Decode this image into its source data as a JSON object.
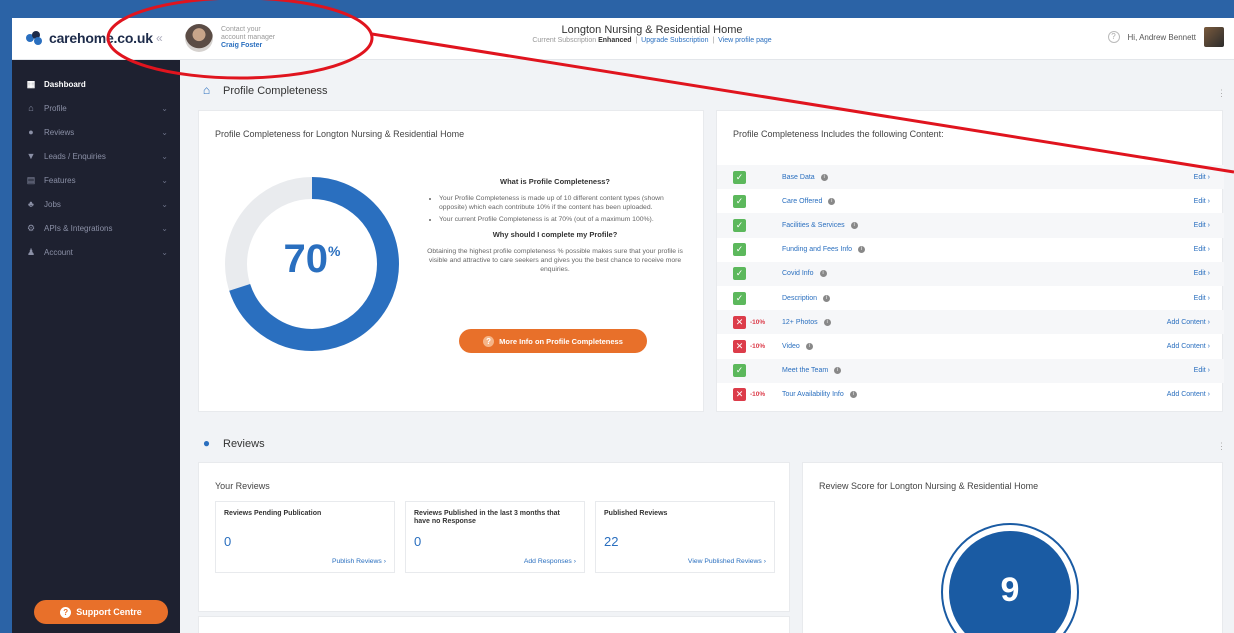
{
  "app": {
    "logo": "carehome.co.uk",
    "collapse": "«"
  },
  "manager": {
    "line1": "Contact your",
    "line2": "account manager",
    "name": "Craig Foster"
  },
  "header": {
    "title": "Longton Nursing & Residential Home",
    "subscription_label": "Current Subscription",
    "subscription_value": "Enhanced",
    "upgrade": "Upgrade Subscription",
    "view_profile": "View profile page",
    "sep": "|"
  },
  "user": {
    "help": "?",
    "greeting": "Hi, Andrew Bennett"
  },
  "sidebar": {
    "items": [
      {
        "label": "Dashboard",
        "icon": "▦"
      },
      {
        "label": "Profile",
        "icon": "⌂"
      },
      {
        "label": "Reviews",
        "icon": "●"
      },
      {
        "label": "Leads / Enquiries",
        "icon": "▼"
      },
      {
        "label": "Features",
        "icon": "▤"
      },
      {
        "label": "Jobs",
        "icon": "♣"
      },
      {
        "label": "APIs & Integrations",
        "icon": "⚙"
      },
      {
        "label": "Account",
        "icon": "♟"
      }
    ],
    "chevron": "⌄",
    "support": "Support Centre",
    "support_icon": "?"
  },
  "profile_section": {
    "heading": "Profile Completeness",
    "dots": "⋮",
    "card_title": "Profile Completeness for Longton Nursing & Residential Home",
    "percent": "70",
    "percent_sign": "%",
    "percent_value": 0.7,
    "what_title": "What is Profile Completeness?",
    "bullet1": "Your Profile Completeness is made up of 10 different content types (shown opposite) which each contribute 10% if the content has been uploaded.",
    "bullet2": "Your current Profile Completeness is at 70% (out of a maximum 100%).",
    "why_title": "Why should I complete my Profile?",
    "why_text": "Obtaining the highest profile completeness % possible makes sure that your profile is visible and attractive to care seekers and gives you the best chance to receive more enquiries.",
    "button": "More Info on Profile Completeness",
    "button_icon": "?",
    "includes_title": "Profile Completeness Includes the following Content:",
    "content": [
      {
        "name": "Base Data",
        "done": true,
        "minus": "",
        "action": "Edit"
      },
      {
        "name": "Care Offered",
        "done": true,
        "minus": "",
        "action": "Edit"
      },
      {
        "name": "Facilities & Services",
        "done": true,
        "minus": "",
        "action": "Edit"
      },
      {
        "name": "Funding and Fees Info",
        "done": true,
        "minus": "",
        "action": "Edit"
      },
      {
        "name": "Covid Info",
        "done": true,
        "minus": "",
        "action": "Edit"
      },
      {
        "name": "Description",
        "done": true,
        "minus": "",
        "action": "Edit"
      },
      {
        "name": "12+ Photos",
        "done": false,
        "minus": "-10%",
        "action": "Add Content"
      },
      {
        "name": "Video",
        "done": false,
        "minus": "-10%",
        "action": "Add Content"
      },
      {
        "name": "Meet the Team",
        "done": true,
        "minus": "",
        "action": "Edit"
      },
      {
        "name": "Tour Availability Info",
        "done": false,
        "minus": "-10%",
        "action": "Add Content"
      }
    ]
  },
  "reviews_section": {
    "heading": "Reviews",
    "dots": "⋮",
    "your_reviews": "Your Reviews",
    "stats": [
      {
        "label": "Reviews Pending Publication",
        "value": "0",
        "action": "Publish Reviews"
      },
      {
        "label": "Reviews Published in the last 3 months that have no Response",
        "value": "0",
        "action": "Add Responses"
      },
      {
        "label": "Published Reviews",
        "value": "22",
        "action": "View Published Reviews"
      }
    ],
    "score_title": "Review Score for Longton Nursing & Residential Home",
    "score": "9"
  },
  "colors": {
    "accent": "#2a6fbf",
    "orange": "#e8702a",
    "sidebar": "#1e2130",
    "ok": "#5cb85c",
    "no": "#dc3c4a",
    "annotation": "#e0141e"
  }
}
